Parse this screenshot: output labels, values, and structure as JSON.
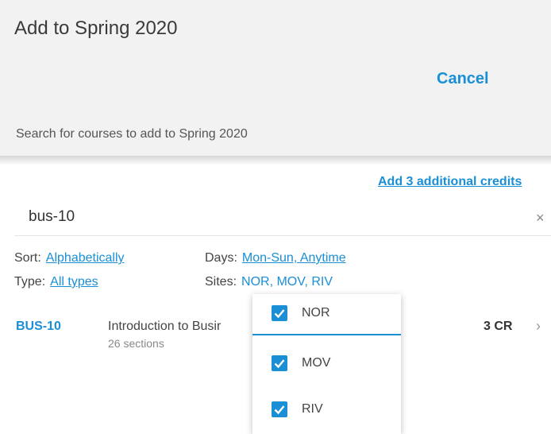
{
  "header": {
    "title": "Add to Spring 2020",
    "cancel_label": "Cancel",
    "subtitle": "Search for courses to add to Spring 2020"
  },
  "add_credits_label": "Add 3 additional credits",
  "search": {
    "value": "bus-10",
    "clear_glyph": "×"
  },
  "filters": {
    "sort_label": "Sort:",
    "sort_value": "Alphabetically",
    "type_label": "Type:",
    "type_value": "All types",
    "days_label": "Days:",
    "days_value": "Mon-Sun, Anytime",
    "sites_label": "Sites:",
    "sites_value": "NOR, MOV, RIV"
  },
  "course": {
    "code": "BUS-10",
    "title": "Introduction to Busir",
    "sections": "26 sections",
    "credits": "3 CR",
    "chevron_glyph": "›"
  },
  "sites_dropdown": {
    "items": [
      {
        "label": "NOR",
        "checked": true
      },
      {
        "label": "MOV",
        "checked": true
      },
      {
        "label": "RIV",
        "checked": true
      }
    ]
  },
  "colors": {
    "accent": "#1a8fd6",
    "header_bg": "#f2f2f2"
  },
  "icons": {
    "clear": "close-icon",
    "chevron": "chevron-right-icon",
    "checkbox": "checkbox-checked-icon"
  }
}
